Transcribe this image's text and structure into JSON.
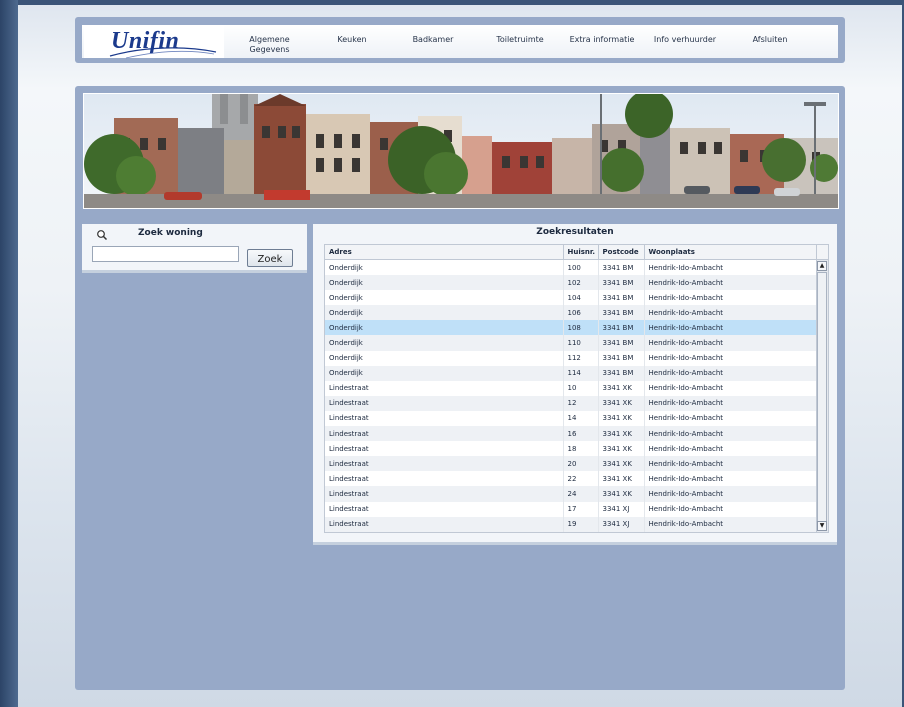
{
  "brand": {
    "logo_text": "Unifin"
  },
  "nav": {
    "items": [
      {
        "label": "Algemene Gegevens"
      },
      {
        "label": "Keuken"
      },
      {
        "label": "Badkamer"
      },
      {
        "label": "Toiletruimte"
      },
      {
        "label": "Extra informatie"
      },
      {
        "label": "Info verhuurder"
      },
      {
        "label": "Afsluiten"
      }
    ]
  },
  "search": {
    "title": "Zoek woning",
    "input_value": "",
    "button_label": "Zoek"
  },
  "results": {
    "title": "Zoekresultaten",
    "columns": [
      "Adres",
      "Huisnr.",
      "Postcode",
      "Woonplaats"
    ],
    "selected_index": 4,
    "rows": [
      [
        "Onderdijk",
        "100",
        "3341 BM",
        "Hendrik-Ido-Ambacht"
      ],
      [
        "Onderdijk",
        "102",
        "3341 BM",
        "Hendrik-Ido-Ambacht"
      ],
      [
        "Onderdijk",
        "104",
        "3341 BM",
        "Hendrik-Ido-Ambacht"
      ],
      [
        "Onderdijk",
        "106",
        "3341 BM",
        "Hendrik-Ido-Ambacht"
      ],
      [
        "Onderdijk",
        "108",
        "3341 BM",
        "Hendrik-Ido-Ambacht"
      ],
      [
        "Onderdijk",
        "110",
        "3341 BM",
        "Hendrik-Ido-Ambacht"
      ],
      [
        "Onderdijk",
        "112",
        "3341 BM",
        "Hendrik-Ido-Ambacht"
      ],
      [
        "Onderdijk",
        "114",
        "3341 BM",
        "Hendrik-Ido-Ambacht"
      ],
      [
        "Lindestraat",
        "10",
        "3341 XK",
        "Hendrik-Ido-Ambacht"
      ],
      [
        "Lindestraat",
        "12",
        "3341 XK",
        "Hendrik-Ido-Ambacht"
      ],
      [
        "Lindestraat",
        "14",
        "3341 XK",
        "Hendrik-Ido-Ambacht"
      ],
      [
        "Lindestraat",
        "16",
        "3341 XK",
        "Hendrik-Ido-Ambacht"
      ],
      [
        "Lindestraat",
        "18",
        "3341 XK",
        "Hendrik-Ido-Ambacht"
      ],
      [
        "Lindestraat",
        "20",
        "3341 XK",
        "Hendrik-Ido-Ambacht"
      ],
      [
        "Lindestraat",
        "22",
        "3341 XK",
        "Hendrik-Ido-Ambacht"
      ],
      [
        "Lindestraat",
        "24",
        "3341 XK",
        "Hendrik-Ido-Ambacht"
      ],
      [
        "Lindestraat",
        "17",
        "3341 XJ",
        "Hendrik-Ido-Ambacht"
      ],
      [
        "Lindestraat",
        "19",
        "3341 XJ",
        "Hendrik-Ido-Ambacht"
      ]
    ]
  },
  "icons": {
    "search": "search-icon",
    "scroll_up": "scroll-up-icon",
    "scroll_down": "scroll-down-icon"
  }
}
